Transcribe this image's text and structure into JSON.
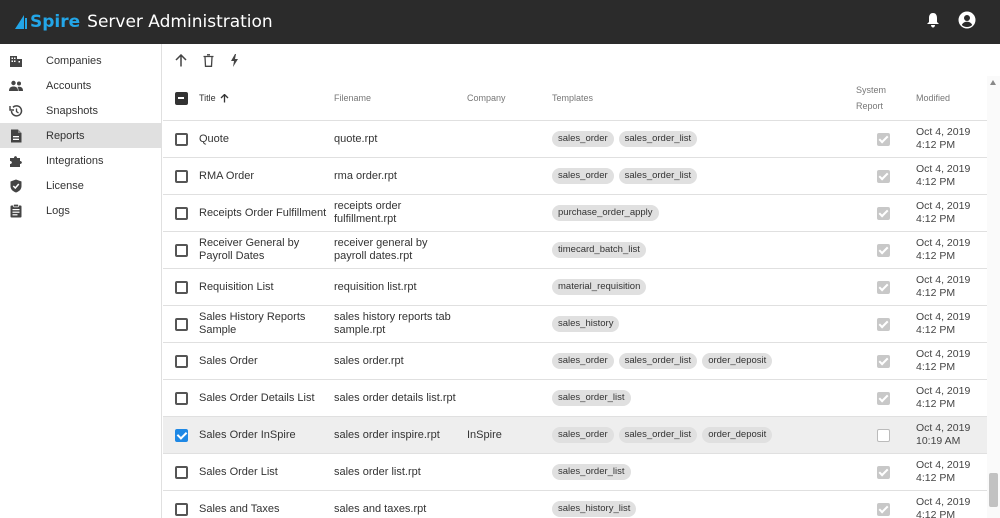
{
  "app": {
    "logo_text": "Spire",
    "title": "Server Administration"
  },
  "topbar": {
    "icons": [
      "bell-icon",
      "account-circle-icon"
    ]
  },
  "sidebar": {
    "items": [
      {
        "label": "Companies",
        "icon": "building-icon",
        "active": false
      },
      {
        "label": "Accounts",
        "icon": "people-icon",
        "active": false
      },
      {
        "label": "Snapshots",
        "icon": "history-icon",
        "active": false
      },
      {
        "label": "Reports",
        "icon": "document-icon",
        "active": true
      },
      {
        "label": "Integrations",
        "icon": "puzzle-icon",
        "active": false
      },
      {
        "label": "License",
        "icon": "shield-check-icon",
        "active": false
      },
      {
        "label": "Logs",
        "icon": "clipboard-icon",
        "active": false
      }
    ]
  },
  "toolbar": {
    "icons": [
      "arrow-up-icon",
      "trash-icon",
      "lightning-icon"
    ]
  },
  "table": {
    "headers": {
      "title": "Title",
      "filename": "Filename",
      "company": "Company",
      "templates": "Templates",
      "system_report_line1": "System",
      "system_report_line2": "Report",
      "modified": "Modified"
    },
    "rows": [
      {
        "title": "Quote",
        "filename": "quote.rpt",
        "company": "",
        "templates": [
          "sales_order",
          "sales_order_list"
        ],
        "system_report": true,
        "selected": false,
        "modified_date": "Oct 4, 2019",
        "modified_time": "4:12 PM"
      },
      {
        "title": "RMA Order",
        "filename": "rma order.rpt",
        "company": "",
        "templates": [
          "sales_order",
          "sales_order_list"
        ],
        "system_report": true,
        "selected": false,
        "modified_date": "Oct 4, 2019",
        "modified_time": "4:12 PM"
      },
      {
        "title": "Receipts Order Fulfillment",
        "filename": "receipts order fulfillment.rpt",
        "company": "",
        "templates": [
          "purchase_order_apply"
        ],
        "system_report": true,
        "selected": false,
        "modified_date": "Oct 4, 2019",
        "modified_time": "4:12 PM"
      },
      {
        "title": "Receiver General by Payroll Dates",
        "filename": "receiver general by payroll dates.rpt",
        "company": "",
        "templates": [
          "timecard_batch_list"
        ],
        "system_report": true,
        "selected": false,
        "modified_date": "Oct 4, 2019",
        "modified_time": "4:12 PM"
      },
      {
        "title": "Requisition List",
        "filename": "requisition list.rpt",
        "company": "",
        "templates": [
          "material_requisition"
        ],
        "system_report": true,
        "selected": false,
        "modified_date": "Oct 4, 2019",
        "modified_time": "4:12 PM"
      },
      {
        "title": "Sales History Reports Sample",
        "filename": "sales history reports tab sample.rpt",
        "company": "",
        "templates": [
          "sales_history"
        ],
        "system_report": true,
        "selected": false,
        "modified_date": "Oct 4, 2019",
        "modified_time": "4:12 PM"
      },
      {
        "title": "Sales Order",
        "filename": "sales order.rpt",
        "company": "",
        "templates": [
          "sales_order",
          "sales_order_list",
          "order_deposit"
        ],
        "system_report": true,
        "selected": false,
        "modified_date": "Oct 4, 2019",
        "modified_time": "4:12 PM"
      },
      {
        "title": "Sales Order Details List",
        "filename": "sales order details list.rpt",
        "company": "",
        "templates": [
          "sales_order_list"
        ],
        "system_report": true,
        "selected": false,
        "modified_date": "Oct 4, 2019",
        "modified_time": "4:12 PM"
      },
      {
        "title": "Sales Order InSpire",
        "filename": "sales order inspire.rpt",
        "company": "InSpire",
        "templates": [
          "sales_order",
          "sales_order_list",
          "order_deposit"
        ],
        "system_report": false,
        "selected": true,
        "modified_date": "Oct 4, 2019",
        "modified_time": "10:19 AM"
      },
      {
        "title": "Sales Order List",
        "filename": "sales order list.rpt",
        "company": "",
        "templates": [
          "sales_order_list"
        ],
        "system_report": true,
        "selected": false,
        "modified_date": "Oct 4, 2019",
        "modified_time": "4:12 PM"
      },
      {
        "title": "Sales and Taxes",
        "filename": "sales and taxes.rpt",
        "company": "",
        "templates": [
          "sales_history_list"
        ],
        "system_report": true,
        "selected": false,
        "modified_date": "Oct 4, 2019",
        "modified_time": "4:12 PM"
      }
    ]
  },
  "colors": {
    "topbar_bg": "#2b2b2b",
    "brand": "#23a6e8",
    "checkbox_selected": "#1e88e5",
    "active_nav_bg": "#e0e0e0"
  }
}
